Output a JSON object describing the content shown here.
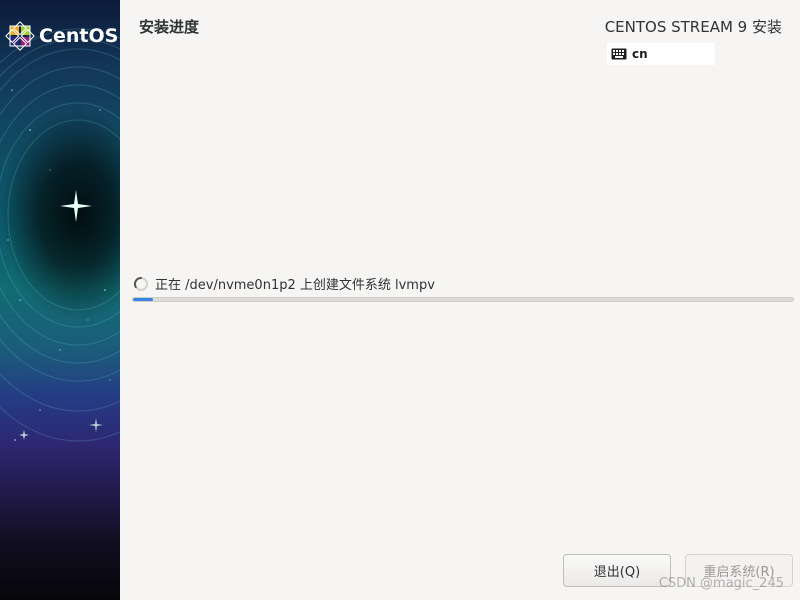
{
  "sidebar": {
    "logo_text": "CentOS"
  },
  "header": {
    "page_title": "安装进度",
    "product_title": "CENTOS STREAM 9 安装",
    "keyboard_layout": "cn"
  },
  "progress": {
    "status_text": "正在 /dev/nvme0n1p2 上创建文件系统 lvmpv",
    "fraction": 0.03
  },
  "buttons": {
    "quit_label": "退出(Q)",
    "reboot_label": "重启系统(R)"
  },
  "watermark": "CSDN @magic_245",
  "colors": {
    "accent": "#3584e4",
    "background": "#f6f5f4",
    "text": "#2e3436"
  },
  "icons": {
    "logo": "centos-logo-icon",
    "keyboard": "keyboard-icon",
    "spinner": "spinner-icon"
  }
}
